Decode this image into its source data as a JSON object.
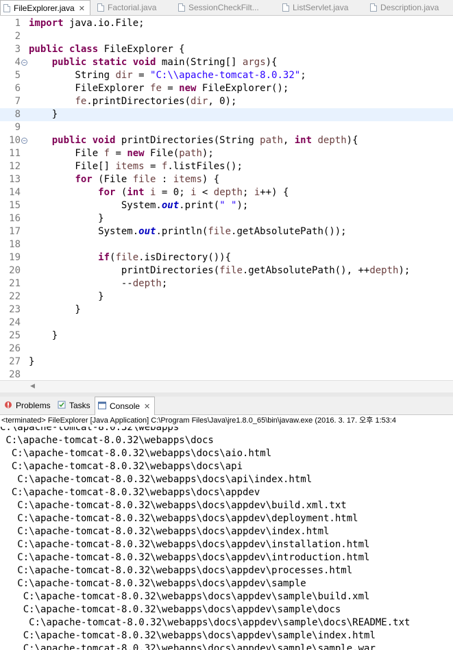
{
  "editor_tabs": [
    {
      "label": "FileExplorer.java",
      "active": true,
      "close": "✕"
    },
    {
      "label": "Factorial.java",
      "active": false
    },
    {
      "label": "SessionCheckFilt...",
      "active": false
    },
    {
      "label": "ListServlet.java",
      "active": false
    },
    {
      "label": "Description.java",
      "active": false
    }
  ],
  "code_lines": [
    {
      "n": "1",
      "html": "<span class=\"kw\">import</span> java.io.File;"
    },
    {
      "n": "2",
      "html": ""
    },
    {
      "n": "3",
      "html": "<span class=\"kw\">public</span> <span class=\"kw\">class</span> FileExplorer {"
    },
    {
      "n": "4",
      "fold": true,
      "html": "    <span class=\"kw\">public</span> <span class=\"kw\">static</span> <span class=\"kw\">void</span> main(String[] <span class=\"var\">args</span>){"
    },
    {
      "n": "5",
      "html": "        String <span class=\"var\">dir</span> = <span class=\"str\">\"C:\\\\apache-tomcat-8.0.32\"</span>;"
    },
    {
      "n": "6",
      "html": "        FileExplorer <span class=\"var\">fe</span> = <span class=\"kw\">new</span> FileExplorer();"
    },
    {
      "n": "7",
      "html": "        <span class=\"var\">fe</span>.printDirectories(<span class=\"var\">dir</span>, 0);"
    },
    {
      "n": "8",
      "current": true,
      "html": "    }"
    },
    {
      "n": "9",
      "html": ""
    },
    {
      "n": "10",
      "fold": true,
      "html": "    <span class=\"kw\">public</span> <span class=\"kw\">void</span> printDirectories(String <span class=\"var\">path</span>, <span class=\"kw\">int</span> <span class=\"var\">depth</span>){"
    },
    {
      "n": "11",
      "html": "        File <span class=\"var\">f</span> = <span class=\"kw\">new</span> File(<span class=\"var\">path</span>);"
    },
    {
      "n": "12",
      "html": "        File[] <span class=\"var\">items</span> = <span class=\"var\">f</span>.listFiles();"
    },
    {
      "n": "13",
      "html": "        <span class=\"kw\">for</span> (File <span class=\"var\">file</span> : <span class=\"var\">items</span>) {"
    },
    {
      "n": "14",
      "html": "            <span class=\"kw\">for</span> (<span class=\"kw\">int</span> <span class=\"var\">i</span> = 0; <span class=\"var\">i</span> &lt; <span class=\"var\">depth</span>; <span class=\"var\">i</span>++) {"
    },
    {
      "n": "15",
      "html": "                System.<span class=\"static\">out</span>.print(<span class=\"str\">\" \"</span>);"
    },
    {
      "n": "16",
      "html": "            }"
    },
    {
      "n": "17",
      "html": "            System.<span class=\"static\">out</span>.println(<span class=\"var\">file</span>.getAbsolutePath());"
    },
    {
      "n": "18",
      "html": ""
    },
    {
      "n": "19",
      "html": "            <span class=\"kw\">if</span>(<span class=\"var\">file</span>.isDirectory()){"
    },
    {
      "n": "20",
      "html": "                printDirectories(<span class=\"var\">file</span>.getAbsolutePath(), ++<span class=\"var\">depth</span>);"
    },
    {
      "n": "21",
      "html": "                --<span class=\"var\">depth</span>;"
    },
    {
      "n": "22",
      "html": "            }"
    },
    {
      "n": "23",
      "html": "        }"
    },
    {
      "n": "24",
      "html": ""
    },
    {
      "n": "25",
      "html": "    }"
    },
    {
      "n": "26",
      "html": ""
    },
    {
      "n": "27",
      "html": "}"
    },
    {
      "n": "28",
      "html": ""
    }
  ],
  "view_tabs": [
    {
      "label": "Problems",
      "icon": "problems-icon",
      "active": false
    },
    {
      "label": "Tasks",
      "icon": "tasks-icon",
      "active": false
    },
    {
      "label": "Console",
      "icon": "console-icon",
      "active": true,
      "close": "✕"
    }
  ],
  "console_status": "<terminated> FileExplorer [Java Application] C:\\Program Files\\Java\\jre1.8.0_65\\bin\\javaw.exe (2016. 3. 17. 오후 1:53:4",
  "console_lines": [
    "C:\\apache-tomcat-8.0.32\\webapps",
    " C:\\apache-tomcat-8.0.32\\webapps\\docs",
    "  C:\\apache-tomcat-8.0.32\\webapps\\docs\\aio.html",
    "  C:\\apache-tomcat-8.0.32\\webapps\\docs\\api",
    "   C:\\apache-tomcat-8.0.32\\webapps\\docs\\api\\index.html",
    "  C:\\apache-tomcat-8.0.32\\webapps\\docs\\appdev",
    "   C:\\apache-tomcat-8.0.32\\webapps\\docs\\appdev\\build.xml.txt",
    "   C:\\apache-tomcat-8.0.32\\webapps\\docs\\appdev\\deployment.html",
    "   C:\\apache-tomcat-8.0.32\\webapps\\docs\\appdev\\index.html",
    "   C:\\apache-tomcat-8.0.32\\webapps\\docs\\appdev\\installation.html",
    "   C:\\apache-tomcat-8.0.32\\webapps\\docs\\appdev\\introduction.html",
    "   C:\\apache-tomcat-8.0.32\\webapps\\docs\\appdev\\processes.html",
    "   C:\\apache-tomcat-8.0.32\\webapps\\docs\\appdev\\sample",
    "    C:\\apache-tomcat-8.0.32\\webapps\\docs\\appdev\\sample\\build.xml",
    "    C:\\apache-tomcat-8.0.32\\webapps\\docs\\appdev\\sample\\docs",
    "     C:\\apache-tomcat-8.0.32\\webapps\\docs\\appdev\\sample\\docs\\README.txt",
    "    C:\\apache-tomcat-8.0.32\\webapps\\docs\\appdev\\sample\\index.html",
    "    C:\\apache-tomcat-8.0.32\\webapps\\docs\\appdev\\sample\\sample.war"
  ]
}
